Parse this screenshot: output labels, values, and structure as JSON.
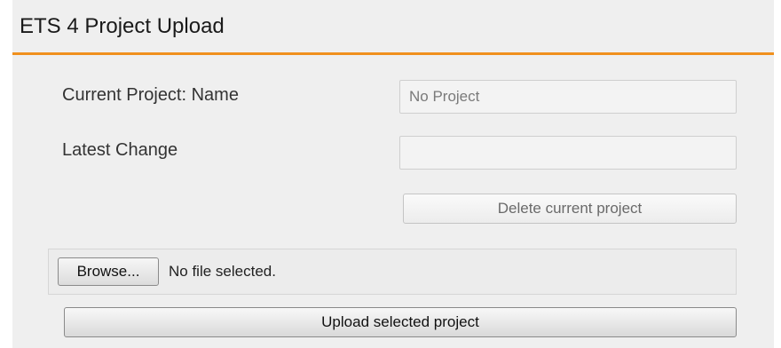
{
  "header": {
    "title": "ETS 4 Project Upload"
  },
  "form": {
    "project_name_label": "Current Project: Name",
    "project_name_value": "No Project",
    "latest_change_label": "Latest Change",
    "latest_change_value": "",
    "delete_button_label": "Delete current project"
  },
  "file_picker": {
    "browse_label": "Browse...",
    "status_text": "No file selected."
  },
  "upload": {
    "button_label": "Upload selected project"
  },
  "colors": {
    "accent": "#f0901e",
    "panel_background": "#efefef"
  }
}
